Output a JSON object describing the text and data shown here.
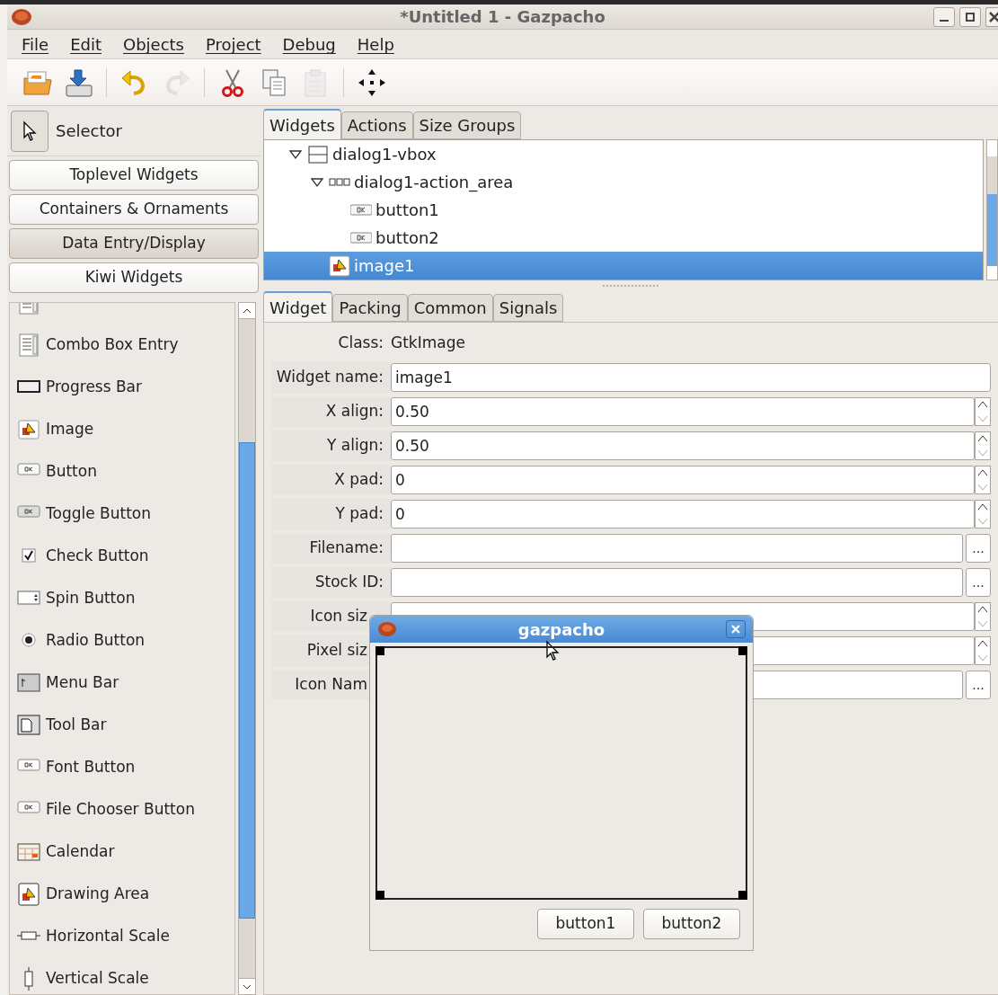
{
  "window": {
    "title": "*Untitled 1 - Gazpacho"
  },
  "menu": [
    "File",
    "Edit",
    "Objects",
    "Project",
    "Debug",
    "Help"
  ],
  "toolbar": [
    {
      "kind": "button",
      "disabled": false
    },
    {
      "kind": "button",
      "disabled": false
    },
    {
      "kind": "separator"
    },
    {
      "kind": "button",
      "disabled": false
    },
    {
      "kind": "button",
      "disabled": true
    },
    {
      "kind": "separator"
    },
    {
      "kind": "button",
      "disabled": false
    },
    {
      "kind": "button",
      "disabled": false
    },
    {
      "kind": "button",
      "disabled": true
    },
    {
      "kind": "separator"
    },
    {
      "kind": "button",
      "disabled": false
    }
  ],
  "palette": {
    "selector": "Selector",
    "groups": [
      {
        "label": "Toplevel Widgets",
        "selected": false
      },
      {
        "label": "Containers & Ornaments",
        "selected": false
      },
      {
        "label": "Data Entry/Display",
        "selected": true
      },
      {
        "label": "Kiwi Widgets",
        "selected": false
      }
    ],
    "items": [
      {
        "kind": "combo"
      },
      {
        "kind": "combo",
        "label": "Combo Box Entry"
      },
      {
        "kind": "progress",
        "label": "Progress Bar"
      },
      {
        "kind": "image",
        "label": "Image"
      },
      {
        "kind": "button",
        "label": "Button"
      },
      {
        "kind": "toggle",
        "label": "Toggle Button"
      },
      {
        "kind": "check",
        "label": "Check Button"
      },
      {
        "kind": "spin",
        "label": "Spin Button"
      },
      {
        "kind": "radio",
        "label": "Radio Button"
      },
      {
        "kind": "menubar",
        "label": "Menu Bar"
      },
      {
        "kind": "toolbar",
        "label": "Tool Bar"
      },
      {
        "kind": "button",
        "label": "Font Button"
      },
      {
        "kind": "button",
        "label": "File Chooser Button"
      },
      {
        "kind": "calendar",
        "label": "Calendar"
      },
      {
        "kind": "drawing",
        "label": "Drawing Area"
      },
      {
        "kind": "hscale",
        "label": "Horizontal Scale"
      },
      {
        "kind": "vscale",
        "label": "Vertical Scale"
      }
    ]
  },
  "tree_tabs": [
    {
      "label": "Widgets",
      "selected": true
    },
    {
      "label": "Actions",
      "selected": false
    },
    {
      "label": "Size Groups",
      "selected": false
    }
  ],
  "tree": [
    {
      "label": "dialog1-vbox",
      "kind": "vbox",
      "expanded": true,
      "selected": false,
      "children": [
        {
          "label": "dialog1-action_area",
          "kind": "hbox",
          "expanded": true,
          "selected": false,
          "children": [
            {
              "label": "button1",
              "kind": "button",
              "selected": false
            },
            {
              "label": "button2",
              "kind": "button",
              "selected": false
            }
          ]
        },
        {
          "label": "image1",
          "kind": "image",
          "selected": true
        }
      ]
    }
  ],
  "editor_tabs": [
    {
      "label": "Widget",
      "selected": true
    },
    {
      "label": "Packing",
      "selected": false
    },
    {
      "label": "Common",
      "selected": false
    },
    {
      "label": "Signals",
      "selected": false
    }
  ],
  "properties": [
    {
      "kind": "text",
      "label": "Class:",
      "value": "GtkImage"
    },
    {
      "kind": "entry",
      "label": "Widget name:",
      "value": "image1"
    },
    {
      "kind": "spin",
      "label": "X align:",
      "value": "0.50"
    },
    {
      "kind": "spin",
      "label": "Y align:",
      "value": "0.50"
    },
    {
      "kind": "spin",
      "label": "X pad:",
      "value": "0"
    },
    {
      "kind": "spin",
      "label": "Y pad:",
      "value": "0"
    },
    {
      "kind": "browse",
      "label": "Filename:",
      "button": "..."
    },
    {
      "kind": "browse",
      "label": "Stock ID:",
      "button": "..."
    },
    {
      "kind": "spin",
      "label": "Icon siz",
      "cut": true
    },
    {
      "kind": "spin",
      "label": "Pixel siz",
      "cut": true
    },
    {
      "kind": "browse",
      "label": "Icon Nam",
      "button": "...",
      "cut": true
    }
  ],
  "preview": {
    "title": "gazpacho",
    "buttons": [
      "button1",
      "button2"
    ]
  }
}
